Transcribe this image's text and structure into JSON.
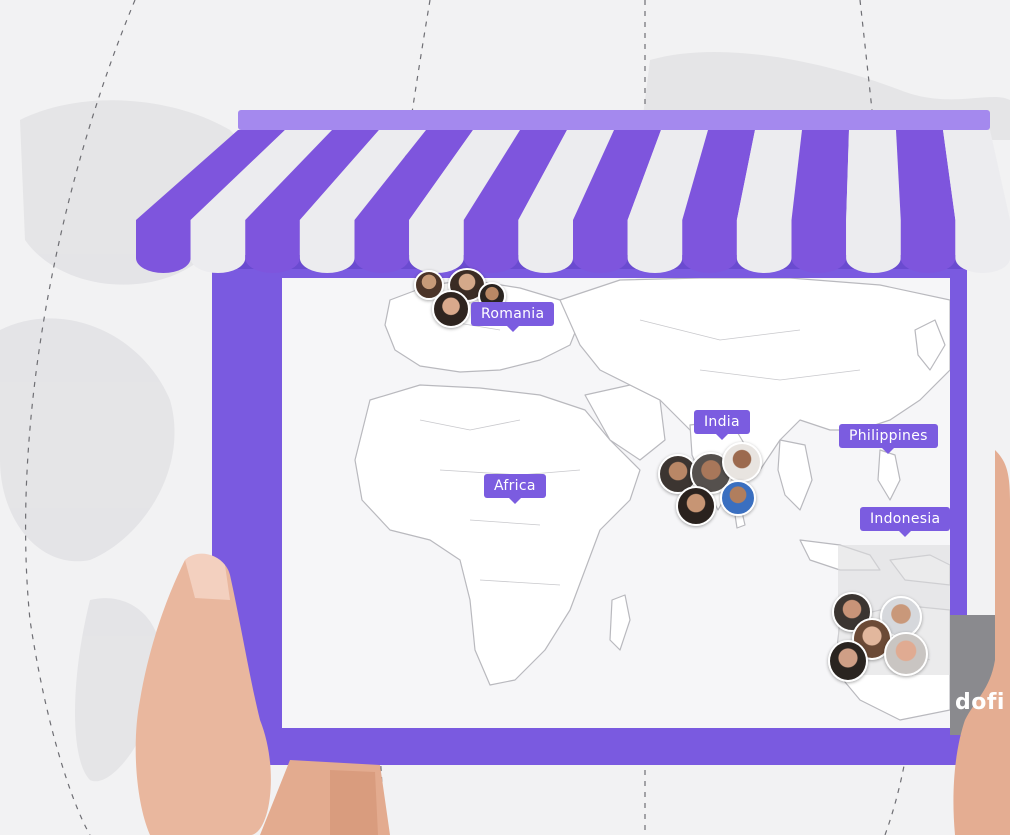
{
  "scene": {
    "colors": {
      "frame": "#7a5ae0",
      "awning_purple": "#7e55dd",
      "awning_white": "#ececef",
      "label_bg": "#7b5ce0",
      "background": "#f2f2f3"
    }
  },
  "map_labels": [
    {
      "id": "romania",
      "text": "Romania"
    },
    {
      "id": "africa",
      "text": "Africa"
    },
    {
      "id": "india",
      "text": "India"
    },
    {
      "id": "philippines",
      "text": "Philippines"
    },
    {
      "id": "indonesia",
      "text": "Indonesia"
    }
  ],
  "brand": {
    "text": "dofi"
  }
}
